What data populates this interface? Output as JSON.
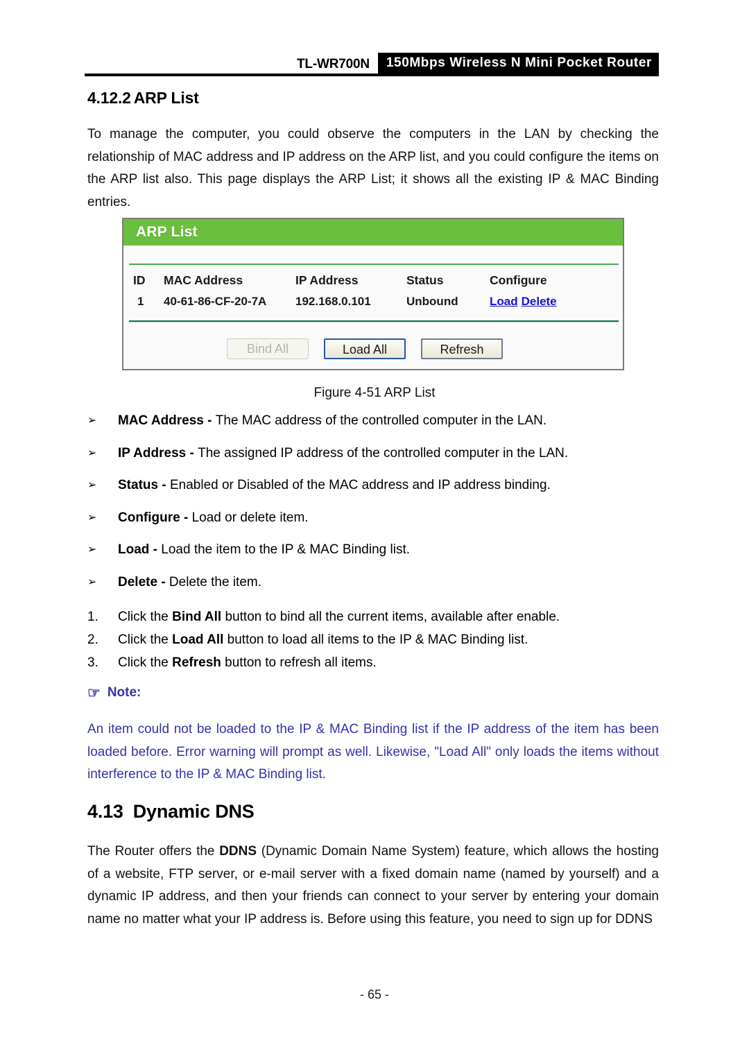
{
  "header": {
    "model": "TL-WR700N",
    "product": "150Mbps Wireless N Mini Pocket Router"
  },
  "section": {
    "number": "4.12.2",
    "title": "ARP List"
  },
  "intro_paragraph": {
    "line1": "To manage the computer, you could observe the computers in the LAN by checking the",
    "line2": "relationship of MAC address and IP address on the ARP list, and you could configure the items on",
    "line3": "the ARP list also. This page displays the ARP List; it shows all the existing IP & MAC Binding",
    "line4": "entries."
  },
  "figure": {
    "panel_title": "ARP List",
    "columns": [
      "ID",
      "MAC Address",
      "IP Address",
      "Status",
      "Configure"
    ],
    "rows": [
      {
        "id": "1",
        "mac": "40-61-86-CF-20-7A",
        "ip": "192.168.0.101",
        "status": "Unbound",
        "configure": {
          "load": "Load",
          "delete": "Delete"
        }
      }
    ],
    "buttons": {
      "bind_all": "Bind All",
      "load_all": "Load All",
      "refresh": "Refresh"
    },
    "caption": "Figure 4-51 ARP List",
    "colors": {
      "title_bar_green": "#6bbf3e",
      "divider_top_green": "#4aa84a",
      "divider_bottom_green": "#15705a",
      "link_blue": "#1414cf"
    }
  },
  "bullets": {
    "glyph": "➢",
    "items": [
      {
        "term": "MAC Address",
        "sep": " - ",
        "desc": "The MAC address of the controlled computer in the LAN."
      },
      {
        "term": "IP Address",
        "sep": " - ",
        "desc": "The assigned IP address of the controlled computer in the LAN."
      },
      {
        "term": "Status",
        "sep": " - ",
        "desc": "Enabled or Disabled of the MAC address and IP address binding."
      },
      {
        "term": "Configure",
        "sep": " - ",
        "desc": "Load or delete item."
      },
      {
        "term": "Load",
        "sep": " - ",
        "desc": "Load the item to the IP & MAC Binding list."
      },
      {
        "term": "Delete",
        "sep": " - ",
        "desc": "Delete the item."
      }
    ]
  },
  "numbered": {
    "items": [
      {
        "marker": "1.",
        "pre": "Click the ",
        "bold": "Bind All",
        "post": " button to bind all the current items, available after enable."
      },
      {
        "marker": "2.",
        "pre": "Click the ",
        "bold": "Load All",
        "post": " button to load all items to the IP & MAC Binding list."
      },
      {
        "marker": "3.",
        "pre": "Click the ",
        "bold": "Refresh",
        "post": " button to refresh all items."
      }
    ]
  },
  "note": {
    "icon": "☞",
    "label": "Note:",
    "color": "#3333a8",
    "line1": "An item could not be loaded to the IP & MAC Binding list if the IP address of the item has been",
    "line2": "loaded before. Error warning will prompt as well. Likewise, \"Load All\" only loads the items without",
    "line3": "interference to the IP & MAC Binding list."
  },
  "ddns": {
    "number": "4.13",
    "title": "Dynamic DNS",
    "para_line1_pre": "The Router offers the ",
    "para_line1_bold": "DDNS",
    "para_line1_post": " (Dynamic Domain Name System) feature, which allows the hosting",
    "para_line2": "of a website, FTP server, or e-mail server with a fixed domain name (named by yourself) and a",
    "para_line3": "dynamic IP address, and then your friends can connect to your server by entering your domain",
    "para_line4": "name no matter what your IP address is. Before using this feature, you need to sign up for DDNS"
  },
  "footer": {
    "page_number": "- 65 -"
  }
}
